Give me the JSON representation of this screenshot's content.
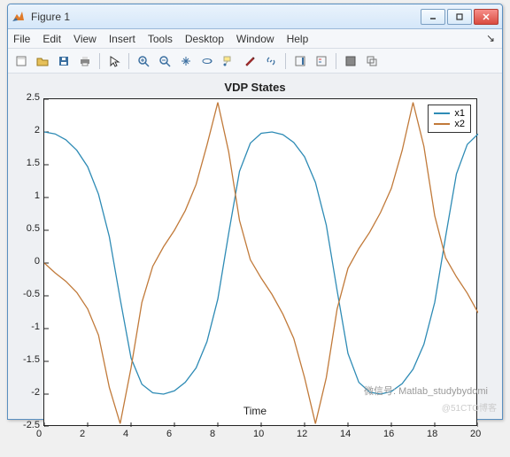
{
  "window": {
    "title": "Figure 1"
  },
  "menu": {
    "items": [
      "File",
      "Edit",
      "View",
      "Insert",
      "Tools",
      "Desktop",
      "Window",
      "Help"
    ]
  },
  "toolbar": {
    "items": [
      "new",
      "open",
      "save",
      "print",
      "|",
      "pointer",
      "|",
      "zoom-in",
      "zoom-out",
      "pan",
      "rotate3d",
      "datatip",
      "brush",
      "link",
      "|",
      "colorbar",
      "legend",
      "|",
      "tile",
      "cascade"
    ]
  },
  "chart_data": {
    "type": "line",
    "title": "VDP States",
    "xlabel": "Time",
    "ylabel": "",
    "xlim": [
      0,
      20
    ],
    "ylim": [
      -2.5,
      2.5
    ],
    "xticks": [
      0,
      2,
      4,
      6,
      8,
      10,
      12,
      14,
      16,
      18,
      20
    ],
    "yticks": [
      -2.5,
      -2,
      -1.5,
      -1,
      -0.5,
      0,
      0.5,
      1,
      1.5,
      2,
      2.5
    ],
    "legend": {
      "position": "northeast",
      "entries": [
        "x1",
        "x2"
      ]
    },
    "series": [
      {
        "name": "x1",
        "color": "#2e8bb5",
        "x": [
          0,
          0.5,
          1,
          1.5,
          2,
          2.5,
          3,
          3.5,
          4,
          4.5,
          5,
          5.5,
          6,
          6.5,
          7,
          7.5,
          8,
          8.5,
          9,
          9.5,
          10,
          10.5,
          11,
          11.5,
          12,
          12.5,
          13,
          13.5,
          14,
          14.5,
          15,
          15.5,
          16,
          16.5,
          17,
          17.5,
          18,
          18.5,
          19,
          19.5,
          20
        ],
        "y": [
          2.0,
          1.97,
          1.88,
          1.72,
          1.47,
          1.05,
          0.4,
          -0.55,
          -1.45,
          -1.85,
          -1.98,
          -2.0,
          -1.95,
          -1.82,
          -1.6,
          -1.2,
          -0.55,
          0.45,
          1.4,
          1.83,
          1.98,
          2.0,
          1.96,
          1.84,
          1.62,
          1.23,
          0.58,
          -0.42,
          -1.38,
          -1.82,
          -1.97,
          -2.0,
          -1.96,
          -1.84,
          -1.62,
          -1.24,
          -0.6,
          0.4,
          1.36,
          1.81,
          1.97
        ]
      },
      {
        "name": "x2",
        "color": "#c17a3a",
        "x": [
          0,
          0.5,
          1,
          1.5,
          2,
          2.5,
          3,
          3.5,
          4,
          4.5,
          5,
          5.5,
          6,
          6.5,
          7,
          7.5,
          8,
          8.5,
          9,
          9.5,
          10,
          10.5,
          11,
          11.5,
          12,
          12.5,
          13,
          13.5,
          14,
          14.5,
          15,
          15.5,
          16,
          16.5,
          17,
          17.5,
          18,
          18.5,
          19,
          19.5,
          20
        ],
        "y": [
          0.0,
          -0.15,
          -0.28,
          -0.45,
          -0.7,
          -1.1,
          -1.9,
          -2.45,
          -1.6,
          -0.6,
          -0.05,
          0.25,
          0.5,
          0.8,
          1.2,
          1.8,
          2.45,
          1.7,
          0.65,
          0.05,
          -0.23,
          -0.48,
          -0.78,
          -1.15,
          -1.75,
          -2.45,
          -1.75,
          -0.7,
          -0.08,
          0.22,
          0.47,
          0.77,
          1.14,
          1.72,
          2.45,
          1.78,
          0.72,
          0.08,
          -0.21,
          -0.46,
          -0.76
        ]
      }
    ]
  },
  "colors": {
    "axis": "#222",
    "series1": "#2e8bb5",
    "series2": "#c17a3a"
  },
  "watermark": {
    "main": "微信号: Matlab_studybydomi",
    "side": "@51CTO博客"
  }
}
